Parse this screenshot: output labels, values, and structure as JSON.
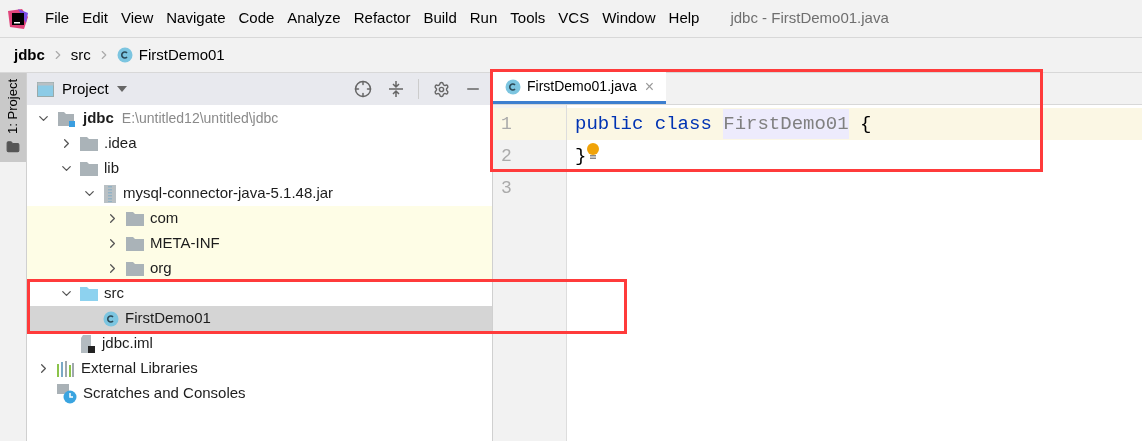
{
  "menu_bar": {
    "items": [
      "File",
      "Edit",
      "View",
      "Navigate",
      "Code",
      "Analyze",
      "Refactor",
      "Build",
      "Run",
      "Tools",
      "VCS",
      "Window",
      "Help"
    ],
    "window_title": "jdbc - FirstDemo01.java"
  },
  "breadcrumbs": [
    {
      "label": "jdbc",
      "kind": "module"
    },
    {
      "label": "src",
      "kind": "folder"
    },
    {
      "label": "FirstDemo01",
      "kind": "class"
    }
  ],
  "tool_stripe": {
    "label": "1: Project",
    "selected": true
  },
  "project_panel": {
    "title": "Project"
  },
  "tree": [
    {
      "label": "jdbc",
      "path": "E:\\untitled12\\untitled\\jdbc",
      "kind": "module",
      "expanded": true,
      "selected": false,
      "highlighted": false,
      "children": [
        {
          "label": ".idea",
          "kind": "folder",
          "expanded": false,
          "selected": false,
          "highlighted": false
        },
        {
          "label": "lib",
          "kind": "folder",
          "expanded": true,
          "selected": false,
          "highlighted": false,
          "children": [
            {
              "label": "mysql-connector-java-5.1.48.jar",
              "kind": "jar",
              "expanded": true,
              "selected": false,
              "highlighted": false,
              "children": [
                {
                  "label": "com",
                  "kind": "folder",
                  "expanded": false,
                  "selected": false,
                  "highlighted": true
                },
                {
                  "label": "META-INF",
                  "kind": "folder",
                  "expanded": false,
                  "selected": false,
                  "highlighted": true
                },
                {
                  "label": "org",
                  "kind": "folder",
                  "expanded": false,
                  "selected": false,
                  "highlighted": true
                }
              ]
            }
          ]
        },
        {
          "label": "src",
          "kind": "source",
          "expanded": true,
          "selected": false,
          "highlighted": false,
          "children": [
            {
              "label": "FirstDemo01",
              "kind": "class",
              "selected": true,
              "highlighted": false
            }
          ]
        },
        {
          "label": "jdbc.iml",
          "kind": "iml",
          "selected": false,
          "highlighted": false
        }
      ]
    },
    {
      "label": "External Libraries",
      "kind": "libraries",
      "expanded": false,
      "selected": false,
      "highlighted": false
    },
    {
      "label": "Scratches and Consoles",
      "kind": "scratches",
      "selected": false,
      "highlighted": false
    }
  ],
  "editor": {
    "tabs": [
      {
        "label": "FirstDemo01.java",
        "selected": true,
        "close": "×"
      }
    ],
    "lines": [
      {
        "number": "1",
        "current": true,
        "tokens": [
          {
            "text": "public class ",
            "kind": "keyword"
          },
          {
            "text": "FirstDemo01",
            "kind": "unused"
          },
          {
            "text": " {",
            "kind": "plain"
          }
        ],
        "bulb": false
      },
      {
        "number": "2",
        "current": false,
        "tokens": [
          {
            "text": "}",
            "kind": "plain"
          }
        ],
        "bulb": true
      },
      {
        "number": "3",
        "current": false,
        "bulb": false
      }
    ]
  }
}
